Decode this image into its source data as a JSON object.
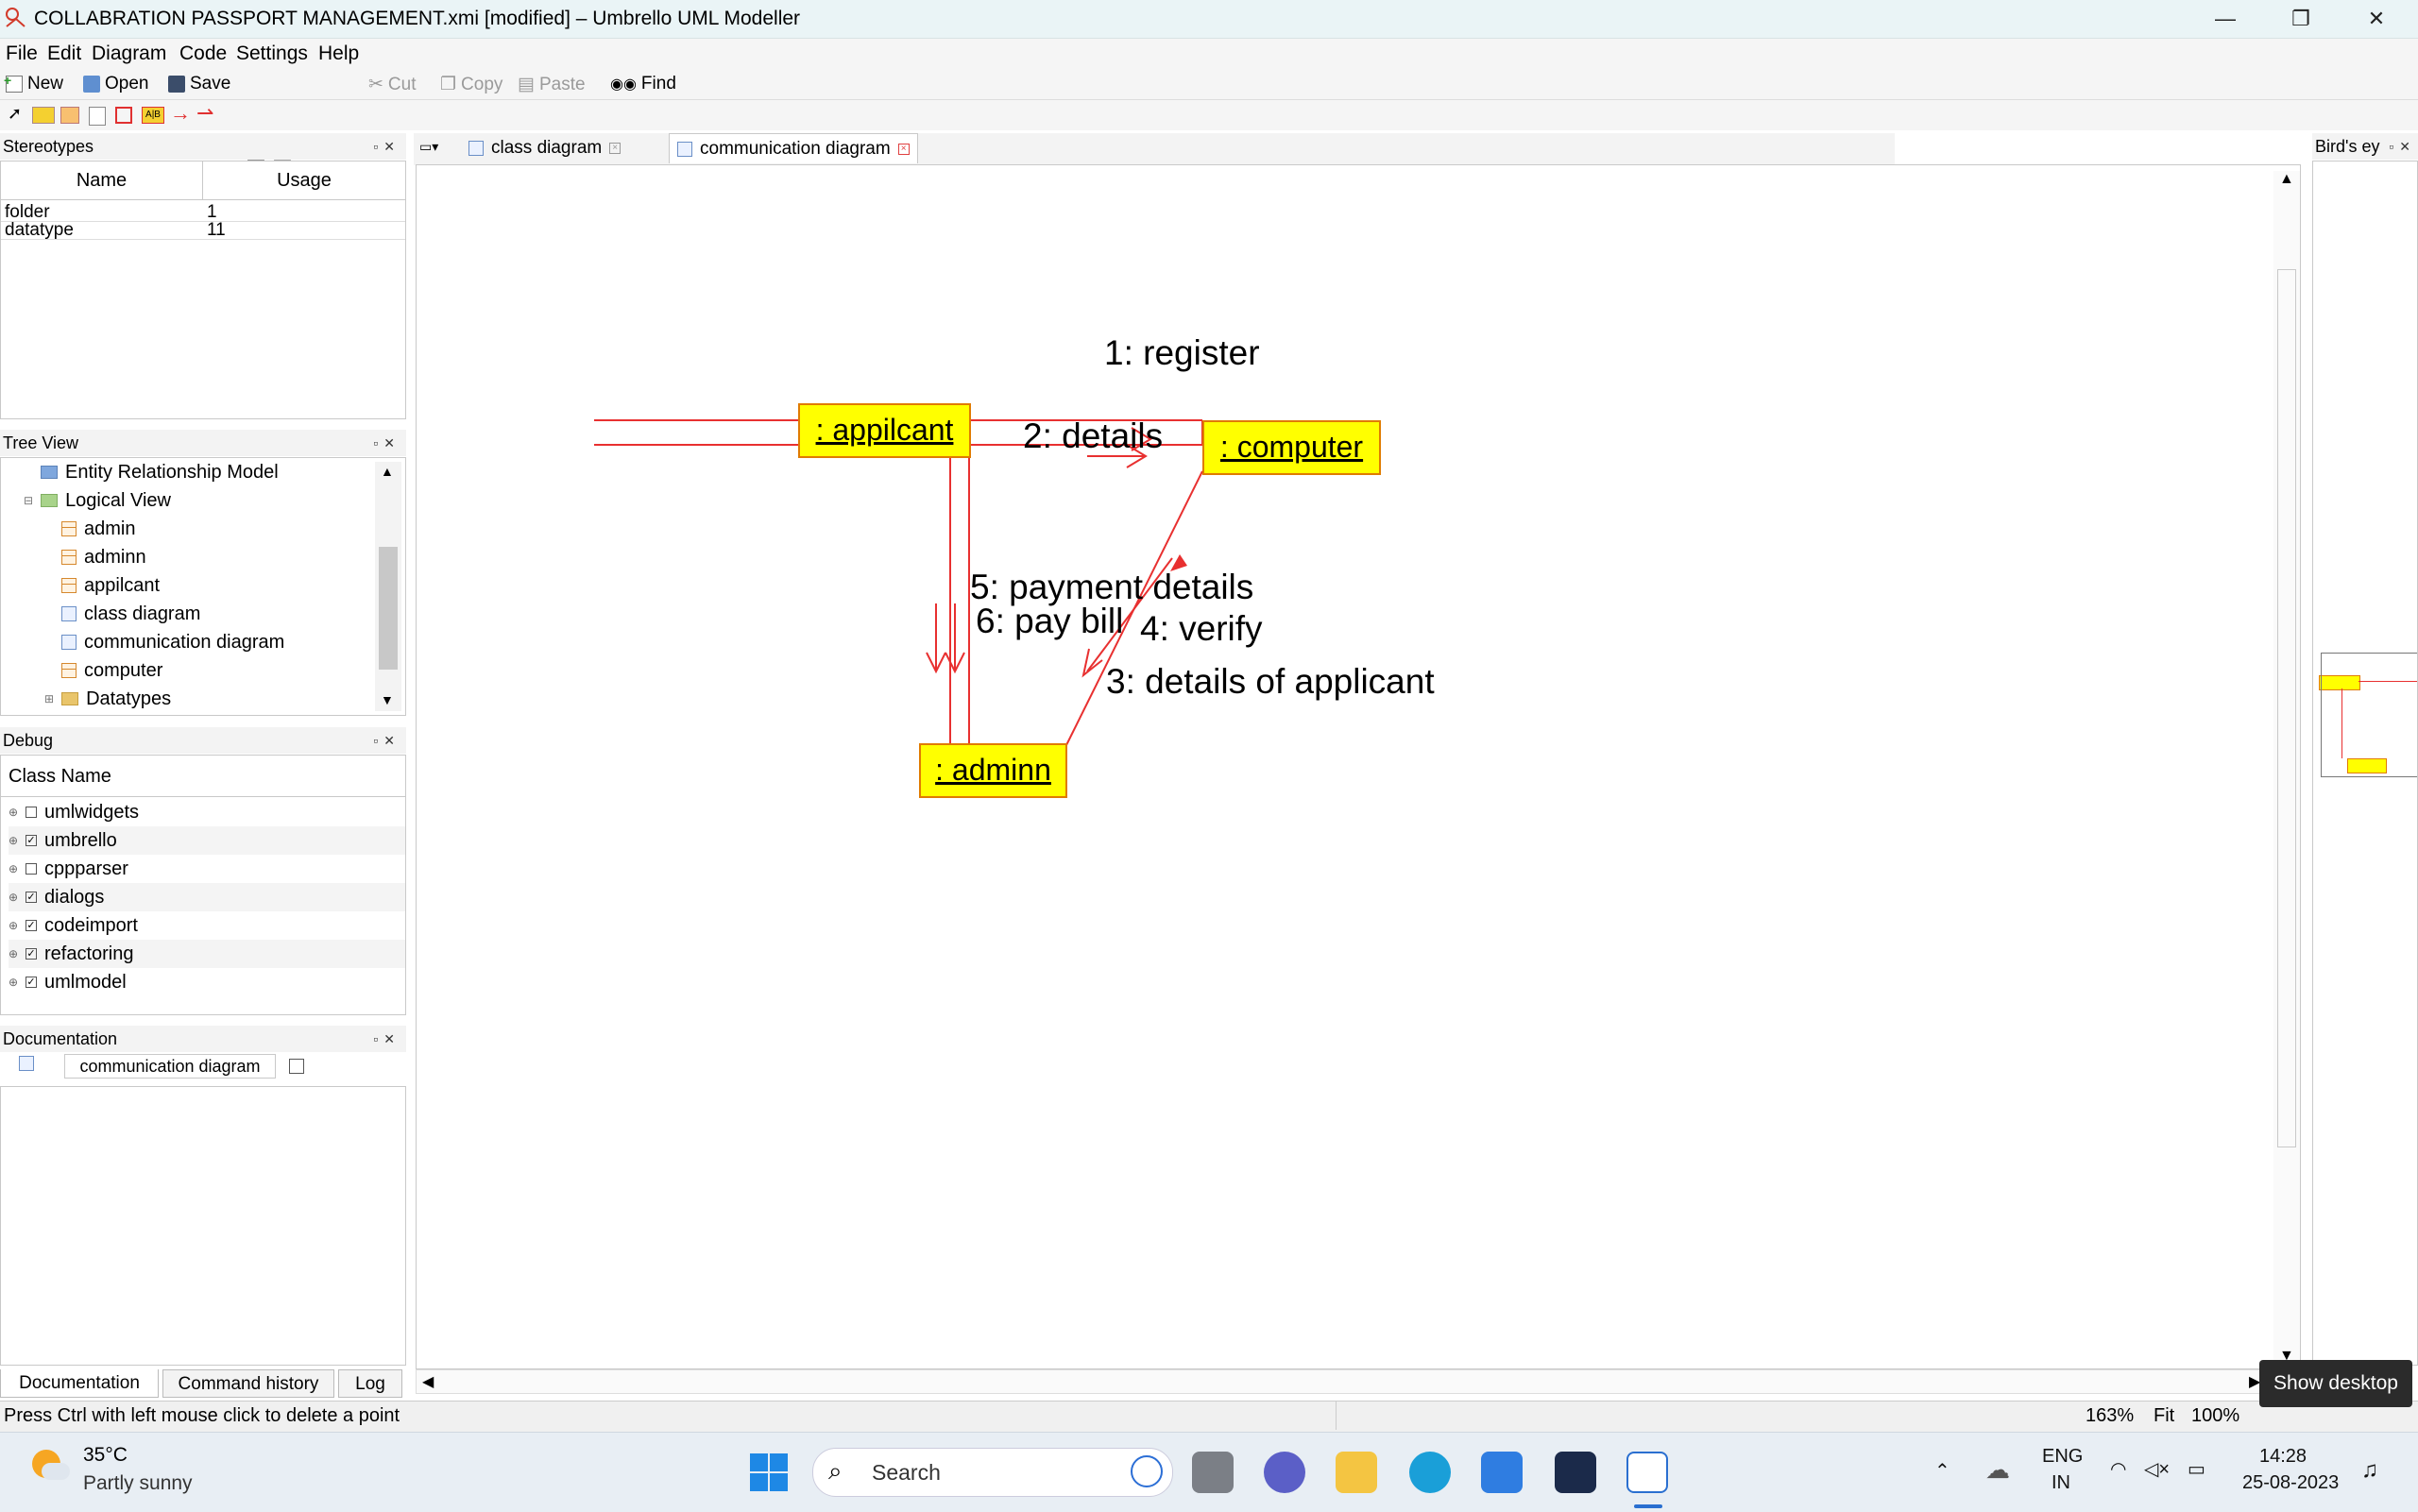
{
  "window": {
    "title": "COLLABRATION PASSPORT MANAGEMENT.xmi [modified] – Umbrello UML Modeller",
    "minimize": "—",
    "restore": "❐",
    "close": "✕"
  },
  "menu": [
    "File",
    "Edit",
    "Diagram",
    "Code",
    "Settings",
    "Help"
  ],
  "toolbar": {
    "new": "New",
    "open": "Open",
    "save": "Save",
    "cut": "Cut",
    "copy": "Copy",
    "paste": "Paste",
    "find": "Find"
  },
  "stereotypes": {
    "title": "Stereotypes",
    "columns": [
      "Name",
      "Usage"
    ],
    "rows": [
      {
        "name": "folder",
        "usage": "1"
      },
      {
        "name": "datatype",
        "usage": "11"
      }
    ]
  },
  "tree_view": {
    "title": "Tree View",
    "items": [
      {
        "label": "Entity Relationship Model",
        "icon": "folder-blue-icon"
      },
      {
        "label": "Logical View",
        "icon": "folder-green-icon"
      },
      {
        "label": "admin",
        "icon": "class-icon"
      },
      {
        "label": "adminn",
        "icon": "class-icon"
      },
      {
        "label": "appilcant",
        "icon": "class-icon"
      },
      {
        "label": "class diagram",
        "icon": "diagram-icon"
      },
      {
        "label": "communication diagram",
        "icon": "diagram-icon"
      },
      {
        "label": "computer",
        "icon": "class-icon"
      },
      {
        "label": "Datatypes",
        "icon": "folder-icon"
      }
    ]
  },
  "debug": {
    "title": "Debug",
    "column": "Class Name",
    "items": [
      {
        "label": "umlwidgets",
        "checked": false
      },
      {
        "label": "umbrello",
        "checked": true
      },
      {
        "label": "cppparser",
        "checked": false
      },
      {
        "label": "dialogs",
        "checked": true
      },
      {
        "label": "codeimport",
        "checked": true
      },
      {
        "label": "refactoring",
        "checked": true
      },
      {
        "label": "umlmodel",
        "checked": true
      }
    ]
  },
  "documentation": {
    "title": "Documentation",
    "field": "communication diagram"
  },
  "bottom_tabs": [
    "Documentation",
    "Command history",
    "Log"
  ],
  "tabs": [
    {
      "label": "class diagram",
      "active": false
    },
    {
      "label": "communication diagram",
      "active": true
    }
  ],
  "diagram": {
    "objects": {
      "applicant": ": appilcant",
      "computer": ": computer",
      "admin": ": adminn"
    },
    "messages": {
      "m1": "1: register",
      "m2": "2: details",
      "m3": "3: details of applicant",
      "m4": "4: verify",
      "m5": "5: payment details",
      "m6": "6: pay bill"
    },
    "object_fill": "#ffff00",
    "object_border": "#e07b00",
    "link_color": "#e83030"
  },
  "birds_eye": {
    "title": "Bird's ey"
  },
  "status": {
    "message": "Press Ctrl with left mouse click to delete a point",
    "zoom": "163%",
    "fit": "Fit",
    "zoom_reset": "100%"
  },
  "tooltip": "Show desktop",
  "taskbar": {
    "weather_temp": "35°C",
    "weather_desc": "Partly sunny",
    "search": "Search",
    "lang1": "ENG",
    "lang2": "IN",
    "time": "14:28",
    "date": "25-08-2023"
  }
}
